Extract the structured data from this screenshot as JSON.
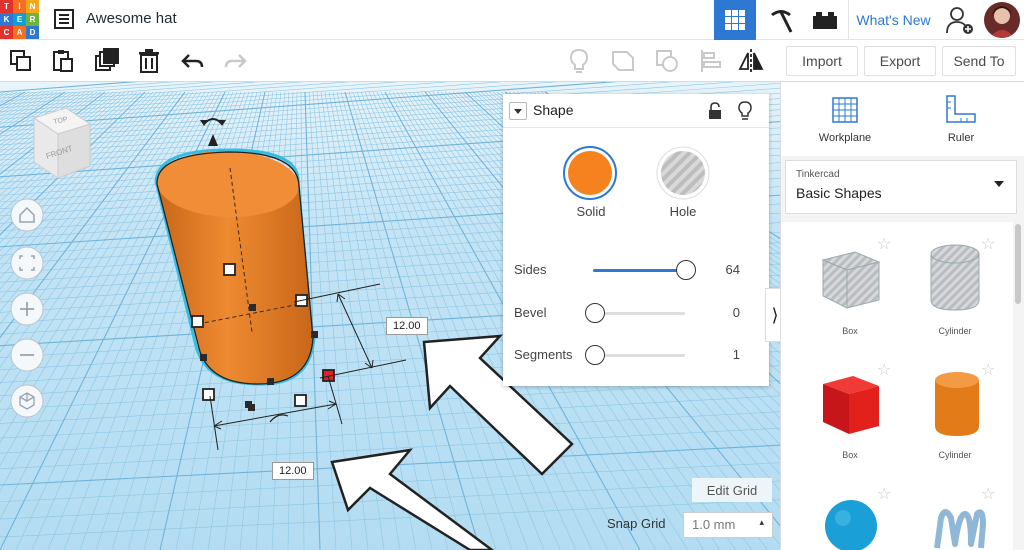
{
  "app": {
    "logo_letters": [
      "T",
      "I",
      "N",
      "K",
      "E",
      "R",
      "C",
      "A",
      "D"
    ],
    "logo_colors": [
      "#e2322d",
      "#f36f21",
      "#f9a61a",
      "#2e78d4",
      "#0f9fd8",
      "#6fb43f",
      "#e2322d",
      "#f36f21",
      "#2e78d4"
    ],
    "title": "Awesome hat",
    "whats_new": "What's New"
  },
  "toolbar": {
    "import": "Import",
    "export": "Export",
    "send_to": "Send To"
  },
  "shape_panel": {
    "title": "Shape",
    "solid_label": "Solid",
    "hole_label": "Hole",
    "solid_color": "#f5821f",
    "sides_label": "Sides",
    "sides_value": "64",
    "bevel_label": "Bevel",
    "bevel_value": "0",
    "segments_label": "Segments",
    "segments_value": "1"
  },
  "sidebar": {
    "workplane_label": "Workplane",
    "ruler_label": "Ruler",
    "library_source": "Tinkercad",
    "library_name": "Basic Shapes",
    "shapes": [
      {
        "label": "Box",
        "color": "#c8c8c8"
      },
      {
        "label": "Cylinder",
        "color": "#c8c8c8"
      },
      {
        "label": "Box",
        "color": "#e2211c"
      },
      {
        "label": "Cylinder",
        "color": "#e8821c"
      }
    ]
  },
  "viewcube": {
    "top": "TOP",
    "front": "FRONT"
  },
  "dimensions": {
    "width_value": "12.00",
    "depth_value": "12.00"
  },
  "grid": {
    "edit_grid": "Edit Grid",
    "snap_label": "Snap Grid",
    "snap_value": "1.0 mm"
  }
}
